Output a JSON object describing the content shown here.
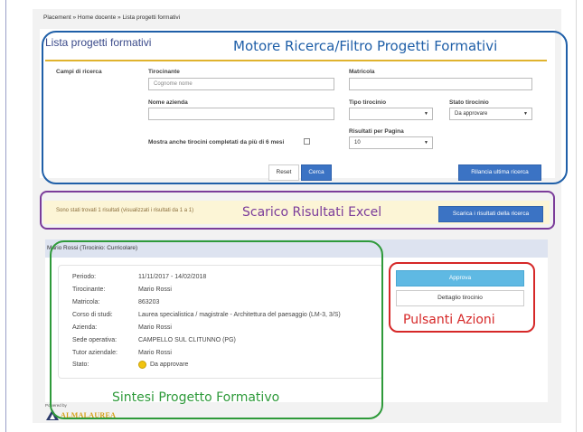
{
  "breadcrumb": {
    "text": "Placement » Home docente » Lista progetti formativi"
  },
  "page": {
    "title": "Lista progetti formativi"
  },
  "search": {
    "section_label": "Campi di ricerca",
    "tirocinante_label": "Tirocinante",
    "tirocinante_placeholder": "Cognome nome",
    "matricola_label": "Matricola",
    "nome_azienda_label": "Nome azienda",
    "tipo_tirocinio_label": "Tipo tirocinio",
    "tipo_tirocinio_value": "",
    "stato_tirocinio_label": "Stato tirocinio",
    "stato_tirocinio_value": "Da approvare",
    "risultati_label": "Risultati per Pagina",
    "risultati_value": "10",
    "mostra_label": "Mostra anche tirocini completati da più di 6 mesi",
    "reset_label": "Reset",
    "cerca_label": "Cerca",
    "rilancia_label": "Rilancia ultima ricerca"
  },
  "results": {
    "message": "Sono stati trovati 1 risultati (visualizzati i risultati da 1 a 1)",
    "download_label": "Scarica i risultati della ricerca"
  },
  "project": {
    "header": "Mario Rossi (Tirocinio: Curricolare)",
    "rows": [
      {
        "key": "Periodo:",
        "value": "11/11/2017 - 14/02/2018"
      },
      {
        "key": "Tirocinante:",
        "value": "Mario Rossi"
      },
      {
        "key": "Matricola:",
        "value": "863203"
      },
      {
        "key": "Corso di studi:",
        "value": "Laurea specialistica / magistrale - Architettura del paesaggio (LM-3, 3/S)"
      },
      {
        "key": "Azienda:",
        "value": "Mario Rossi"
      },
      {
        "key": "Sede operativa:",
        "value": "CAMPELLO SUL CLITUNNO (PG)"
      },
      {
        "key": "Tutor aziendale:",
        "value": "Mario Rossi"
      },
      {
        "key": "Stato:",
        "value": "Da approvare"
      }
    ],
    "status_color": "#f1c40f",
    "approva_label": "Approva",
    "dettaglio_label": "Dettaglio tirocinio"
  },
  "footer": {
    "powered": "Powered by",
    "logo_text": "ALMALAUREA"
  },
  "annotations": {
    "motore": "Motore Ricerca/Filtro Progetti Formativi",
    "scarico": "Scarico Risultati Excel",
    "pulsanti": "Pulsanti Azioni",
    "sintesi": "Sintesi Progetto Formativo",
    "colors": {
      "blue": "#1f5fa8",
      "purple": "#7b3c9a",
      "red": "#d62828",
      "green": "#2e9a3a"
    }
  },
  "theme": {
    "accent_gold": "#e0b32e",
    "primary_blue": "#3b73c4",
    "info_blue": "#5fb9e3"
  }
}
